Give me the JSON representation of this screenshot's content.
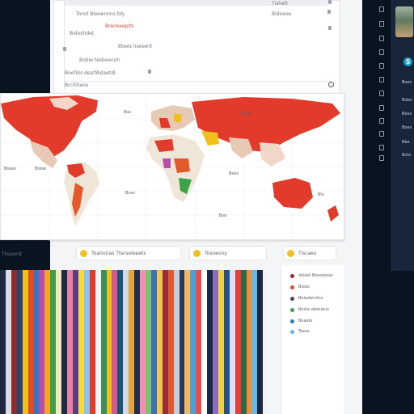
{
  "top_card": {
    "rows": [
      {
        "text": "Tonst Bleeemins tdy",
        "style": "plain"
      },
      {
        "text": "Brenkeepits",
        "style": "red"
      },
      {
        "text": "Bidoshdet",
        "style": "plain"
      },
      {
        "text": "Btees lisesent",
        "style": "plain"
      },
      {
        "text": "Bobie tesbeecoh",
        "style": "plain"
      },
      {
        "text": "Boefdis deaf",
        "style": "plain"
      },
      {
        "text": "Bidaetdl",
        "style": "plain"
      },
      {
        "text": "Brcliitieos",
        "style": "plain"
      }
    ],
    "right_header": "Tishelt",
    "right_value": "Bidoeee"
  },
  "map": {
    "labels": [
      "Bsoes",
      "Brese",
      "Bse",
      "Bces",
      "Bees",
      "Bts",
      "Bsd",
      "Bmes"
    ]
  },
  "pills": [
    {
      "label": "Toanoiras Ttersoleeets",
      "icon": "info-icon"
    },
    {
      "label": "Tosoeony",
      "icon": "info-icon"
    },
    {
      "label": "Tiscaes",
      "icon": "info-icon"
    }
  ],
  "pill_left_text": "Tiiseonit",
  "legend": {
    "items": [
      {
        "label": "Voiest Boosteoas",
        "color": "#8e2b2b"
      },
      {
        "label": "Bieds",
        "color": "#e04a2e"
      },
      {
        "label": "Boiadeicitos",
        "color": "#3f4a5c"
      },
      {
        "label": "Boste deesieus",
        "color": "#3aa34a"
      },
      {
        "label": "Beaats",
        "color": "#2f78c4"
      },
      {
        "label": "Teess",
        "color": "#6cb4e8"
      }
    ]
  },
  "sidebar": {
    "labels": [
      "Boes",
      "Bsbe",
      "Beos",
      "Boes",
      "Bbe",
      "Bots"
    ]
  },
  "colors": {
    "accent_red": "#e23a2b",
    "accent_yellow": "#f0c01f",
    "sidebar_bg": "#17263a"
  },
  "stripe_colors": [
    "#1e2a44",
    "#d8dde6",
    "#8e2b2b",
    "#29466e",
    "#f0c01f",
    "#e04a2e",
    "#2f78c4",
    "#b84ea8",
    "#f2a71d",
    "#3aa34a",
    "#f5e7c2",
    "#1e2a44",
    "#e8829e",
    "#5b3a86",
    "#f6d842",
    "#89c6ea",
    "#e23a2b",
    "#f4f4f4",
    "#3c8f5a",
    "#f0c01f",
    "#d45a8a",
    "#1f4f7a",
    "#cfd9e6",
    "#e9a23b",
    "#20304a",
    "#f48fb1",
    "#7ac36a",
    "#3f6fb6",
    "#f2c64e",
    "#9c2b3c",
    "#e05a2b",
    "#c4ccd8",
    "#263b5e",
    "#f6b85c",
    "#4aa2d8",
    "#e94e4e",
    "#ffffff",
    "#1b2a40",
    "#8d6ac3",
    "#f3d13c",
    "#23508e",
    "#d7e3ee",
    "#e83c3c",
    "#2b6a46",
    "#f08c3a",
    "#6ab7e6",
    "#1a2740",
    "#f2f2f2"
  ]
}
